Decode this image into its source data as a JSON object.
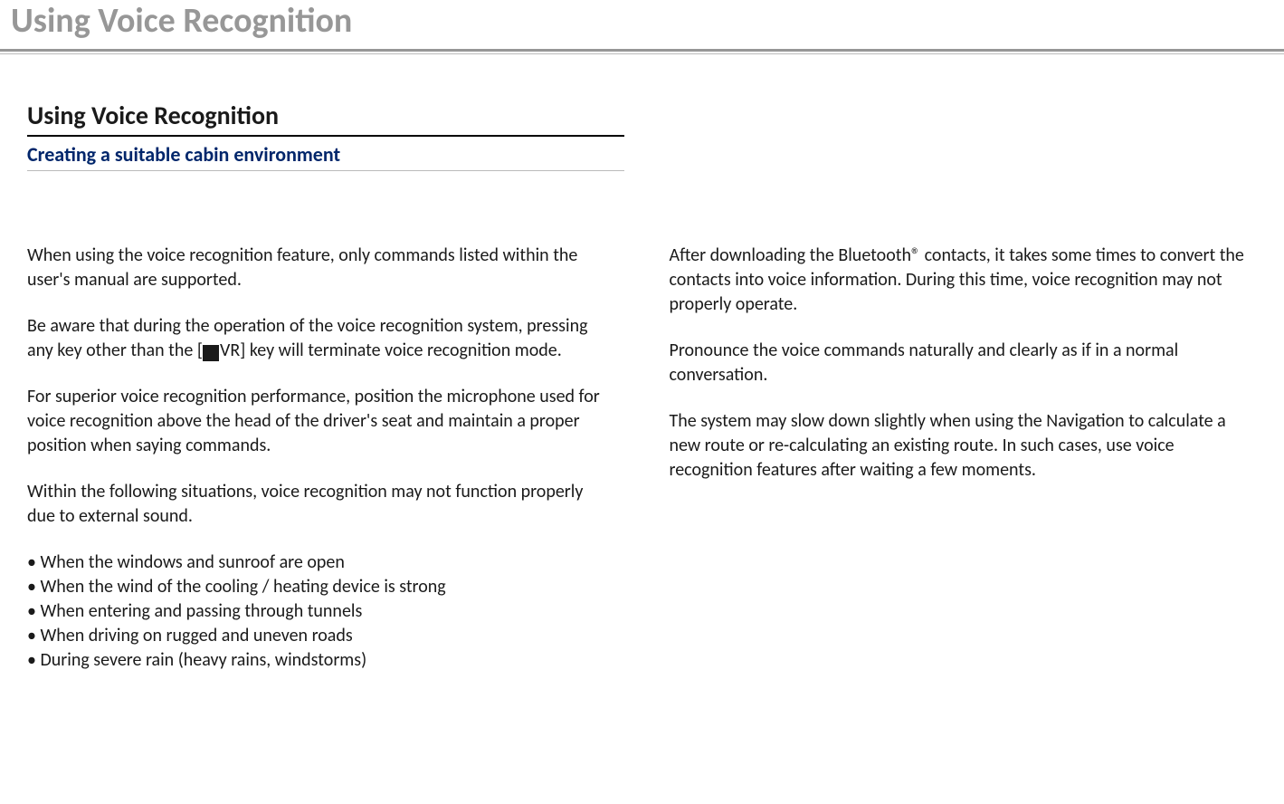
{
  "page_title": "Using Voice Recognition",
  "section_heading": "Using Voice Recognition",
  "sub_heading": "Creating a suitable cabin environment",
  "left_column": {
    "p1": "When using the voice recognition feature, only commands listed within the user's manual are supported.",
    "p2_a": "Be aware that during the operation of the voice recognition system, pressing any key other than the [",
    "p2_b": "VR] key will terminate voice recognition mode.",
    "p3": "For superior voice recognition performance, position the microphone used for voice recognition above the head of the driver's seat and maintain a proper position when saying commands.",
    "p4": "Within the following situations, voice recognition may not function properly due to external sound.",
    "bullets": [
      "• When the windows and sunroof are open",
      "• When the wind of the cooling / heating device is strong",
      "• When entering and passing through tunnels",
      "• When driving on rugged and uneven roads",
      "• During severe rain (heavy rains, windstorms)"
    ]
  },
  "right_column": {
    "p1": "After downloading the Bluetooth® contacts, it takes some times to convert the contacts into voice information. During this time, voice recognition may not properly operate.",
    "p2": "Pronounce the voice commands naturally and clearly as if in a normal conversation.",
    "p3": "The system may slow down slightly when using the Navigation to calculate a new route or re-calculating an existing route. In such cases, use voice recognition features after waiting a few moments."
  }
}
